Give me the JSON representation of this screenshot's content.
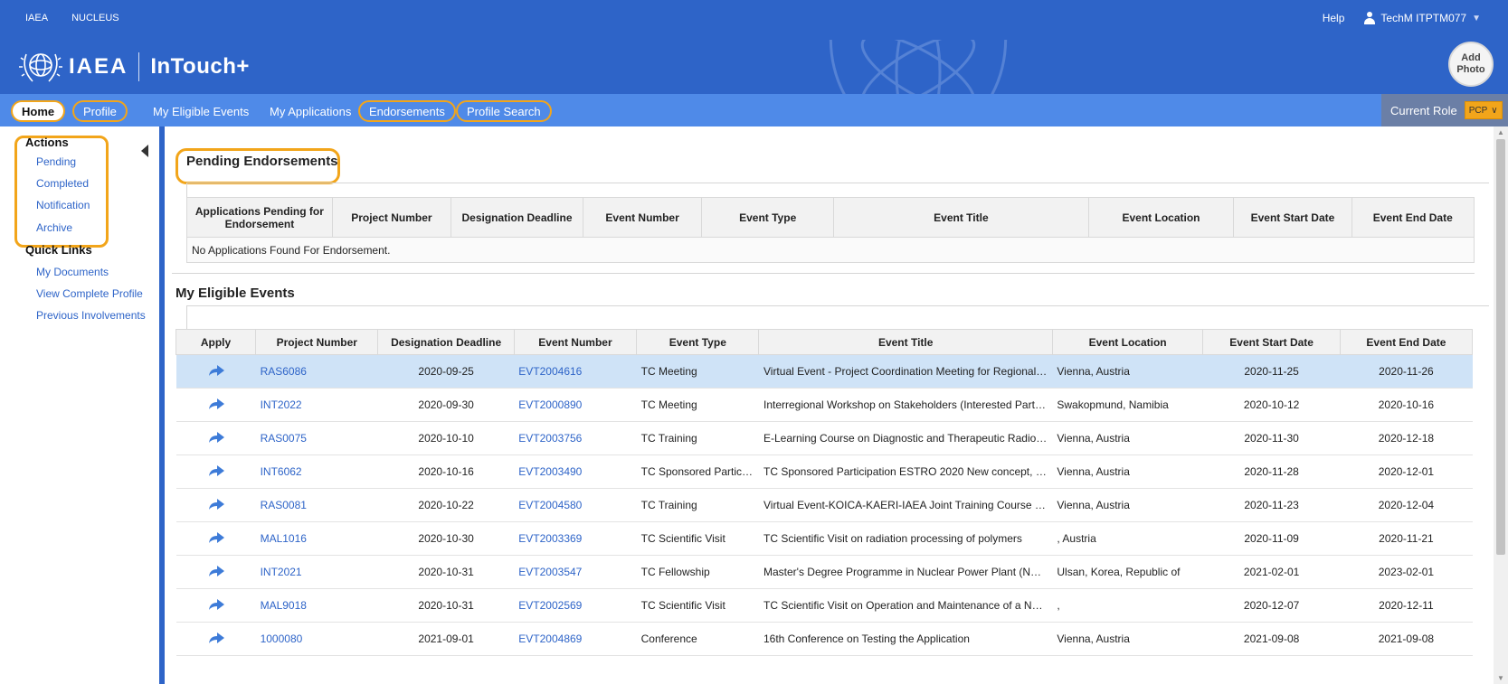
{
  "topbar": {
    "links": [
      "IAEA",
      "NUCLEUS"
    ],
    "help": "Help",
    "user": "TechM ITPTM077"
  },
  "header": {
    "org": "IAEA",
    "app": "InTouch+",
    "add_photo_line1": "Add",
    "add_photo_line2": "Photo"
  },
  "nav": {
    "items": [
      "Home",
      "Profile",
      "My Eligible Events",
      "My Applications",
      "Endorsements",
      "Profile Search"
    ],
    "current_role_label": "Current Role",
    "current_role_value": "PCP"
  },
  "sidebar": {
    "actions_heading": "Actions",
    "actions": [
      "Pending",
      "Completed",
      "Notification",
      "Archive"
    ],
    "quick_links_heading": "Quick Links",
    "quick_links": [
      "My Documents",
      "View Complete Profile",
      "Previous Involvements"
    ]
  },
  "pending": {
    "title": "Pending Endorsements",
    "columns": [
      "Applications Pending for Endorsement",
      "Project Number",
      "Designation Deadline",
      "Event Number",
      "Event Type",
      "Event Title",
      "Event Location",
      "Event Start Date",
      "Event End Date"
    ],
    "empty_message": "No Applications Found For Endorsement."
  },
  "eligible": {
    "title": "My Eligible Events",
    "columns": [
      "Apply",
      "Project Number",
      "Designation Deadline",
      "Event Number",
      "Event Type",
      "Event Title",
      "Event Location",
      "Event Start Date",
      "Event End Date"
    ],
    "rows": [
      {
        "project": "RAS6086",
        "deadline": "2020-09-25",
        "event": "EVT2004616",
        "type": "TC Meeting",
        "title": "Virtual Event - Project Coordination Meeting for Regional P...",
        "location": "Vienna, Austria",
        "start": "2020-11-25",
        "end": "2020-11-26"
      },
      {
        "project": "INT2022",
        "deadline": "2020-09-30",
        "event": "EVT2000890",
        "type": "TC Meeting",
        "title": "Interregional Workshop on Stakeholders (Interested Parties...",
        "location": "Swakopmund, Namibia",
        "start": "2020-10-12",
        "end": "2020-10-16"
      },
      {
        "project": "RAS0075",
        "deadline": "2020-10-10",
        "event": "EVT2003756",
        "type": "TC Training",
        "title": "E-Learning Course on Diagnostic and Therapeutic Radioisot...",
        "location": "Vienna, Austria",
        "start": "2020-11-30",
        "end": "2020-12-18"
      },
      {
        "project": "INT6062",
        "deadline": "2020-10-16",
        "event": "EVT2003490",
        "type": "TC Sponsored Particip...",
        "title": "TC Sponsored Participation ESTRO 2020 New concept, new...",
        "location": "Vienna, Austria",
        "start": "2020-11-28",
        "end": "2020-12-01"
      },
      {
        "project": "RAS0081",
        "deadline": "2020-10-22",
        "event": "EVT2004580",
        "type": "TC Training",
        "title": "Virtual Event-KOICA-KAERI-IAEA Joint Training Course on F...",
        "location": "Vienna, Austria",
        "start": "2020-11-23",
        "end": "2020-12-04"
      },
      {
        "project": "MAL1016",
        "deadline": "2020-10-30",
        "event": "EVT2003369",
        "type": "TC Scientific Visit",
        "title": "TC Scientific Visit on radiation processing of polymers",
        "location": ", Austria",
        "start": "2020-11-09",
        "end": "2020-11-21"
      },
      {
        "project": "INT2021",
        "deadline": "2020-10-31",
        "event": "EVT2003547",
        "type": "TC Fellowship",
        "title": "Master's Degree Programme in Nuclear Power Plant (NPP)...",
        "location": "Ulsan, Korea, Republic of",
        "start": "2021-02-01",
        "end": "2023-02-01"
      },
      {
        "project": "MAL9018",
        "deadline": "2020-10-31",
        "event": "EVT2002569",
        "type": "TC Scientific Visit",
        "title": "TC Scientific Visit on Operation and Maintenance of a New...",
        "location": ",",
        "start": "2020-12-07",
        "end": "2020-12-11"
      },
      {
        "project": "1000080",
        "deadline": "2021-09-01",
        "event": "EVT2004869",
        "type": "Conference",
        "title": "16th Conference on Testing the Application",
        "location": "Vienna, Austria",
        "start": "2021-09-08",
        "end": "2021-09-08"
      }
    ]
  },
  "colors": {
    "brand_blue": "#2e64c8",
    "nav_blue": "#4f8ae8",
    "highlight_orange": "#f2a51a",
    "selected_row": "#cfe3f7"
  },
  "icons": {
    "apply": "share-arrow-icon",
    "user": "user-icon",
    "collapse": "chevron-left-icon",
    "logo": "un-emblem-icon"
  }
}
